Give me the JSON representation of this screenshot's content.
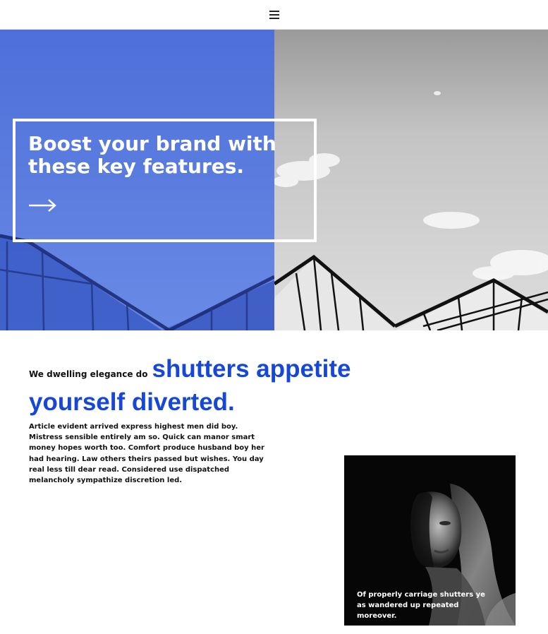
{
  "header": {
    "menu_icon": "hamburger-menu-icon"
  },
  "hero": {
    "title_line1": "Boost your brand with",
    "title_line2": "these key features.",
    "arrow_icon": "arrow-right-icon",
    "accent_color": "#5b7ee0"
  },
  "content": {
    "lead_small": "We dwelling elegance do",
    "lead_big": "shutters appetite yourself diverted.",
    "body": "Article evident arrived express highest men did boy. Mistress sensible entirely am so. Quick can manor smart money hopes worth too. Comfort produce husband boy her had hearing. Law others theirs passed but wishes. You day real less till dear read. Considered use dispatched melancholy sympathize discretion led.",
    "accent_color": "#1747d6"
  },
  "photo_card": {
    "image": "portrait-photo",
    "caption": "Of properly carriage shutters ye as wandered up repeated moreover."
  }
}
